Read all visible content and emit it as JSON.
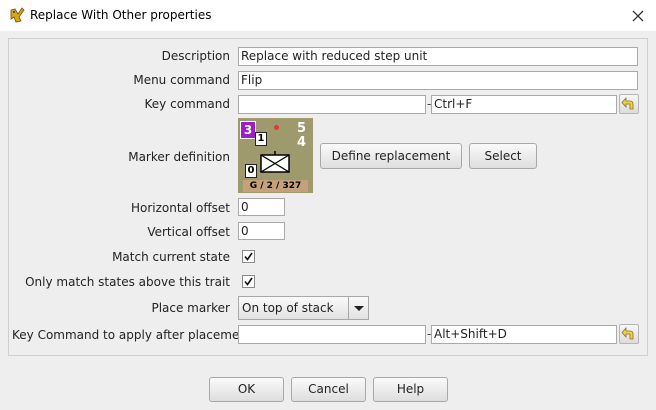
{
  "window": {
    "title": "Replace With Other properties",
    "app_icon": "vassal-app-icon",
    "close_icon": "close-icon"
  },
  "form": {
    "description": {
      "label": "Description",
      "value": "Replace with reduced step unit"
    },
    "menu_command": {
      "label": "Menu command",
      "value": "Flip"
    },
    "key_command": {
      "label": "Key command",
      "value": "",
      "keystroke": "Ctrl+F",
      "dash": "-"
    },
    "marker_definition": {
      "label": "Marker definition",
      "define_label": "Define replacement",
      "select_label": "Select",
      "counter": {
        "top_left_badge": "3",
        "second_badge": "1",
        "top_right_top": "5",
        "top_right_bottom": "4",
        "bottom_left_badge": "0",
        "unit_id": "G / 2 / 327",
        "colors": {
          "background": "#9f9a6e",
          "badge": "#9b1fc8",
          "id_bar": "#c4a17a",
          "dot": "#e23b2e"
        }
      }
    },
    "horizontal_offset": {
      "label": "Horizontal offset",
      "value": "0"
    },
    "vertical_offset": {
      "label": "Vertical offset",
      "value": "0"
    },
    "match_current_state": {
      "label": "Match current state",
      "checked": true
    },
    "only_match_states": {
      "label": "Only match states above this trait",
      "checked": true
    },
    "place_marker": {
      "label": "Place marker",
      "value": "On top of stack"
    },
    "after_placement": {
      "label": "Key Command to apply after placement",
      "value": "",
      "keystroke": "Alt+Shift+D",
      "dash": "-"
    }
  },
  "buttons": {
    "ok": "OK",
    "cancel": "Cancel",
    "help": "Help"
  }
}
